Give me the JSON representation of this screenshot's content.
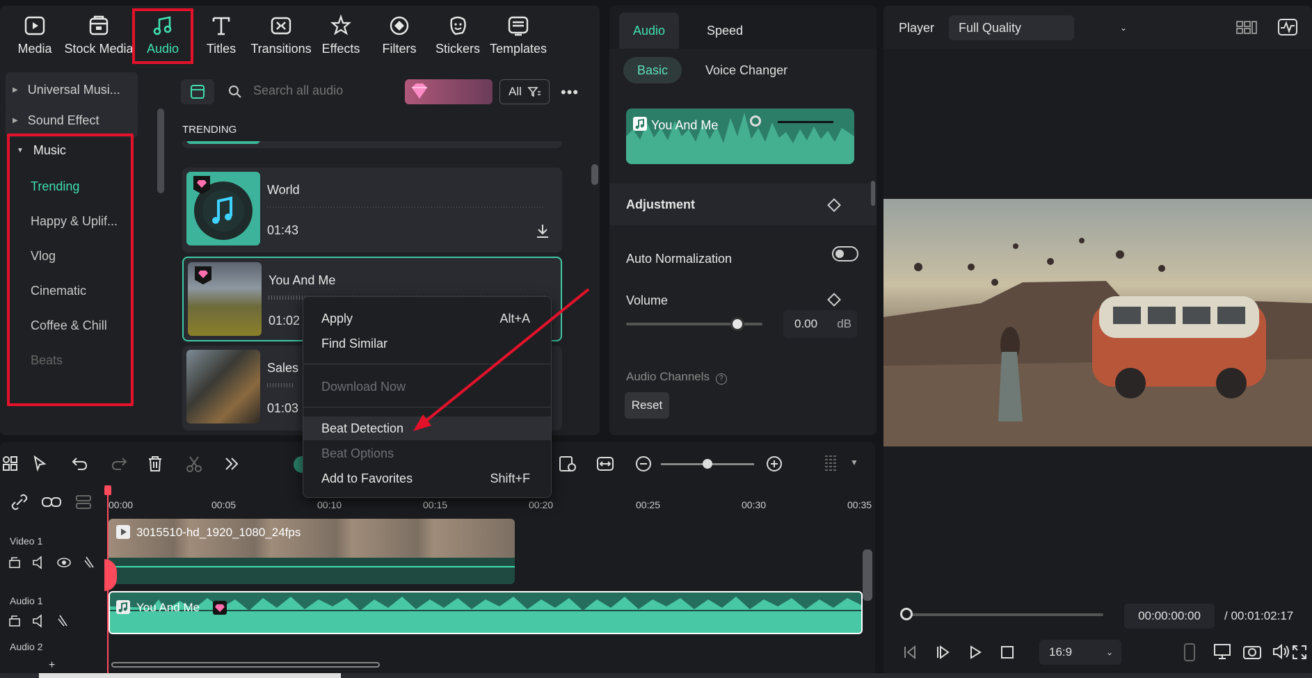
{
  "toolbar": {
    "tabs": [
      {
        "label": "Media",
        "icon": "media-icon"
      },
      {
        "label": "Stock Media",
        "icon": "stock-media-icon"
      },
      {
        "label": "Audio",
        "icon": "music-note-icon"
      },
      {
        "label": "Titles",
        "icon": "titles-icon"
      },
      {
        "label": "Transitions",
        "icon": "transitions-icon"
      },
      {
        "label": "Effects",
        "icon": "effects-icon"
      },
      {
        "label": "Filters",
        "icon": "filters-icon"
      },
      {
        "label": "Stickers",
        "icon": "stickers-icon"
      },
      {
        "label": "Templates",
        "icon": "templates-icon"
      }
    ],
    "active": "Audio"
  },
  "sidebar": {
    "groups": [
      "Universal Musi...",
      "Sound Effect"
    ],
    "music": {
      "label": "Music",
      "items": [
        "Trending",
        "Happy & Uplif...",
        "Vlog",
        "Cinematic",
        "Coffee & Chill",
        "Beats"
      ],
      "active": "Trending"
    }
  },
  "search": {
    "placeholder": "Search all audio",
    "filter": "All"
  },
  "list": {
    "section": "TRENDING",
    "items": [
      {
        "name": "World",
        "duration": "01:43"
      },
      {
        "name": "You And Me",
        "duration": "01:02"
      },
      {
        "name": "Sales S",
        "duration": "01:03"
      }
    ]
  },
  "context_menu": {
    "items": [
      {
        "label": "Apply",
        "shortcut": "Alt+A"
      },
      {
        "label": "Find Similar",
        "shortcut": ""
      },
      {
        "label": "Download Now",
        "shortcut": ""
      },
      {
        "label": "Beat Detection",
        "shortcut": ""
      },
      {
        "label": "Beat Options",
        "shortcut": ""
      },
      {
        "label": "Add to Favorites",
        "shortcut": "Shift+F"
      }
    ]
  },
  "properties": {
    "tabs": [
      "Audio",
      "Speed"
    ],
    "subtabs": [
      "Basic",
      "Voice Changer"
    ],
    "clip_name": "You And Me",
    "adjustment": "Adjustment",
    "auto_normalization": "Auto Normalization",
    "volume_label": "Volume",
    "volume_value": "0.00",
    "volume_unit": "dB",
    "audio_channels": "Audio Channels",
    "reset": "Reset"
  },
  "player": {
    "title": "Player",
    "quality": "Full Quality",
    "current_time": "00:00:00:00",
    "total_time": "/  00:01:02:17",
    "aspect": "16:9"
  },
  "timeline": {
    "ruler": [
      "00:00",
      "00:05",
      "00:10",
      "00:15",
      "00:20",
      "00:25",
      "00:30",
      "00:35"
    ],
    "tracks": [
      "Video 1",
      "Audio 1",
      "Audio 2"
    ],
    "video_clip": "3015510-hd_1920_1080_24fps",
    "audio_clip": "You And Me",
    "add_track": "+"
  },
  "colors": {
    "accent": "#3fe0b0",
    "highlight": "#e3122a",
    "audio_clip": "#256d5d"
  }
}
